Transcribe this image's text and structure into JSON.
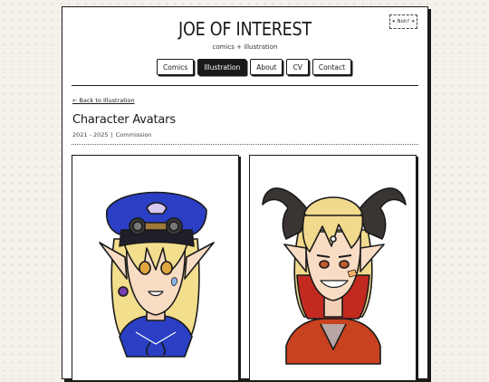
{
  "header": {
    "title": "JOE OF INTEREST",
    "tagline": "comics + illustration",
    "theme_toggle": "✦ Noh? ✦"
  },
  "nav": [
    {
      "label": "Comics",
      "active": false
    },
    {
      "label": "Illustration",
      "active": true
    },
    {
      "label": "About",
      "active": false
    },
    {
      "label": "CV",
      "active": false
    },
    {
      "label": "Contact",
      "active": false
    }
  ],
  "page": {
    "back_link": "← Back to Illustration",
    "title": "Character Avatars",
    "years": "2021 - 2025",
    "separator": "|",
    "category": "Commission"
  },
  "gallery": {
    "items": [
      {
        "subject": "elf in blue captain hat with goggles",
        "colors": {
          "hat": "#2a3fc4",
          "hair": "#f3de8e",
          "outfit": "#2a3fc4",
          "skin": "#f9dcc4"
        }
      },
      {
        "subject": "horned character with blonde-to-red hair",
        "colors": {
          "horns": "#3a3533",
          "hair": "#f1d98d",
          "hair_tips": "#c22a20",
          "jacket": "#c8421f",
          "skin": "#f9dcc4"
        }
      }
    ]
  }
}
